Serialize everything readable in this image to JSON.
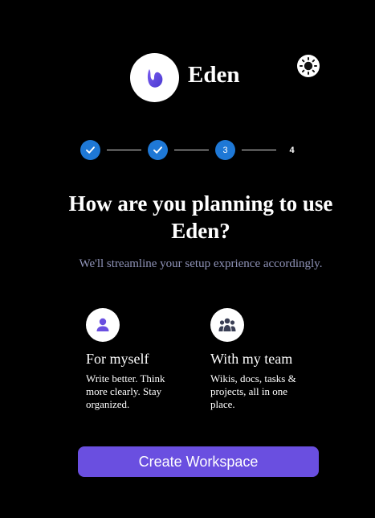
{
  "header": {
    "app_name": "Eden",
    "logo_icon": "eden-logo-icon",
    "theme_toggle_icon": "sun-icon"
  },
  "stepper": {
    "steps": [
      {
        "label": "",
        "state": "complete"
      },
      {
        "label": "",
        "state": "complete"
      },
      {
        "label": "3",
        "state": "current"
      },
      {
        "label": "4",
        "state": "upcoming"
      }
    ]
  },
  "main": {
    "heading": "How are you planning to use Eden?",
    "subheading": "We'll streamline your setup exprience accordingly."
  },
  "options": [
    {
      "icon": "user-icon",
      "title": "For myself",
      "description": "Write better. Think more clearly. Stay organized."
    },
    {
      "icon": "team-icon",
      "title": "With my team",
      "description": "Wikis, docs, tasks & projects, all in one place."
    }
  ],
  "actions": {
    "create_label": "Create Workspace"
  },
  "colors": {
    "background": "#000000",
    "accent": "#6a4fe0",
    "step_active": "#1e78d6",
    "subtext": "#8f93b8"
  }
}
